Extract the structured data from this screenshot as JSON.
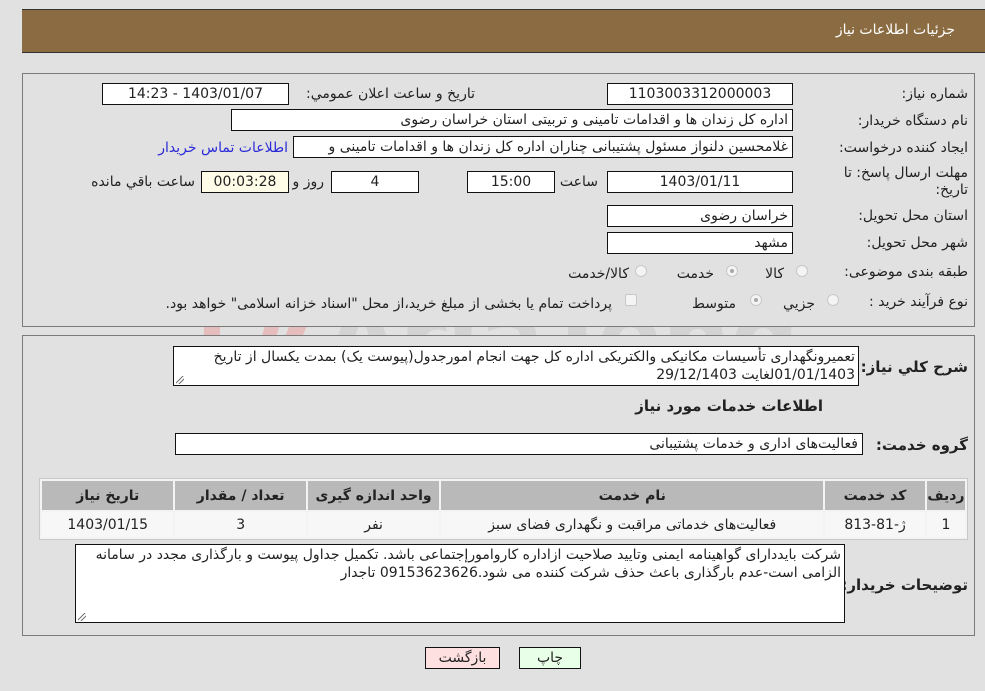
{
  "header": {
    "title": "جزئیات اطلاعات نیاز"
  },
  "fields": {
    "need_number": {
      "label": "شماره نیاز:",
      "value": "1103003312000003"
    },
    "announce_datetime": {
      "label": "تاریخ و ساعت اعلان عمومي:",
      "value": "1403/01/07 - 14:23"
    },
    "buyer_org": {
      "label": "نام دستگاه خریدار:",
      "value": "اداره کل زندان ها و اقدامات تامینی و تربیتی استان خراسان رضوی"
    },
    "requester": {
      "label": "ایجاد کننده درخواست:",
      "value": "غلامحسین دلنواز مسئول پشتیبانی چناران اداره کل زندان ها و اقدامات تامینی و"
    },
    "buyer_contact_link": "اطلاعات تماس خریدار",
    "deadline": {
      "label": "مهلت ارسال پاسخ: تا تاریخ:",
      "date": "1403/01/11",
      "time_label": "ساعت",
      "time": "15:00",
      "days": "4",
      "days_label": "روز و",
      "remaining": "00:03:28",
      "remaining_label": "ساعت باقي مانده"
    },
    "delivery_province": {
      "label": "استان محل تحویل:",
      "value": "خراسان رضوی"
    },
    "delivery_city": {
      "label": "شهر محل تحویل:",
      "value": "مشهد"
    },
    "category": {
      "label": "طبقه بندی موضوعی:",
      "options": [
        "کالا",
        "خدمت",
        "کالا/خدمت"
      ],
      "selected": "خدمت"
    },
    "purchase_type": {
      "label": "نوع فرآیند خرید :",
      "options": [
        "جزيي",
        "متوسط"
      ],
      "selected": "متوسط",
      "treasury_checkbox_label": "پرداخت تمام یا بخشی از مبلغ خرید،از محل \"اسناد خزانه اسلامی\" خواهد بود.",
      "treasury_checked": false
    }
  },
  "description": {
    "label": "شرح کلي نیاز:",
    "value": "تعمیرونگهداری تأسیسات مکانیکی والکتریکی اداره کل جهت انجام امورجدول(پیوست یک) بمدت یکسال از تاریخ 01/01/1403لغایت 29/12/1403"
  },
  "services_section": {
    "title": "اطلاعات خدمات مورد نیاز",
    "group_label": "گروه خدمت:",
    "group_value": "فعالیت‌های اداری و خدمات پشتیبانی",
    "table": {
      "headers": [
        "ردیف",
        "کد خدمت",
        "نام خدمت",
        "واحد اندازه گیری",
        "تعداد / مقدار",
        "تاریخ نیاز"
      ],
      "rows": [
        [
          "1",
          "ژ-81-813",
          "فعالیت‌های خدماتی مراقبت و نگهداری فضای سبز",
          "نفر",
          "3",
          "1403/01/15"
        ]
      ]
    },
    "buyer_notes_label": "توضیحات خریدار:",
    "buyer_notes": "شرکت بایددارای گواهینامه ایمنی وتایید صلاحیت ازاداره کاروامورإجتماعی باشد. تکمیل جداول پیوست و بارگذاری مجدد در سامانه الزامی است-عدم بارگذاری باعث حذف شرکت کننده می شود.09153623626 تاجدار"
  },
  "buttons": {
    "print": "چاپ",
    "back": "بازگشت"
  },
  "watermark": {
    "text": "AriaTender.neT"
  },
  "colors": {
    "header_bg": "#8b6c42",
    "link": "#2a2ad8",
    "back_btn": "#ffe0e0",
    "print_btn": "#e8ffe8",
    "remaining_bg": "#fffde8"
  }
}
